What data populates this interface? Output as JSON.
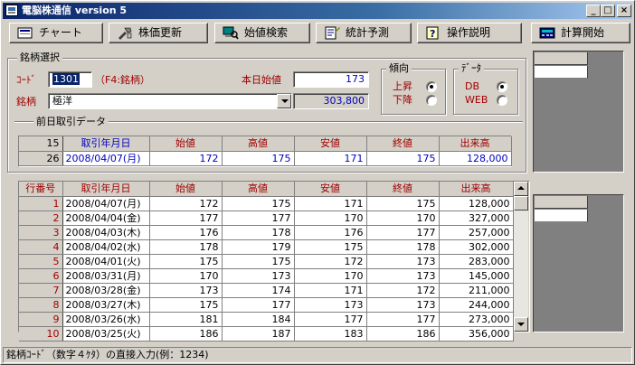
{
  "window": {
    "title": "電脳株通信 version 5",
    "min_label": "_",
    "max_label": "□",
    "close_label": "×"
  },
  "toolbar": {
    "chart": "チャート",
    "price_update": "株価更新",
    "open_search": "始値検索",
    "stat_forecast": "統計予測",
    "manual": "操作説明",
    "calc_start": "計算開始"
  },
  "selection": {
    "group_label": "銘柄選択",
    "code_label": "ｺｰﾄﾞ",
    "code_value": "1301",
    "code_hint": "（F4:銘柄）",
    "today_open_label": "本日始値",
    "today_open_value": "173",
    "name_label": "銘柄",
    "name_value": "極洋",
    "volume_value": "303,800"
  },
  "trend": {
    "group_label": "傾向",
    "up_label": "上昇",
    "down_label": "下降",
    "selected": "up"
  },
  "datasource": {
    "group_label": "ﾃﾞｰﾀ",
    "db_label": "DB",
    "web_label": "WEB",
    "selected": "DB"
  },
  "prev_day": {
    "group_label": "前日取引データ",
    "count": "15",
    "headers": [
      "取引年月日",
      "始値",
      "高値",
      "安値",
      "終値",
      "出来高"
    ],
    "row": {
      "num": "26",
      "date": "2008/04/07(月)",
      "open": "172",
      "high": "175",
      "low": "171",
      "close": "175",
      "volume": "128,000"
    }
  },
  "history": {
    "headers": [
      "行番号",
      "取引年月日",
      "始値",
      "高値",
      "安値",
      "終値",
      "出来高"
    ],
    "rows": [
      {
        "num": "1",
        "date": "2008/04/07(月)",
        "open": "172",
        "high": "175",
        "low": "171",
        "close": "175",
        "volume": "128,000"
      },
      {
        "num": "2",
        "date": "2008/04/04(金)",
        "open": "177",
        "high": "177",
        "low": "170",
        "close": "170",
        "volume": "327,000"
      },
      {
        "num": "3",
        "date": "2008/04/03(木)",
        "open": "176",
        "high": "178",
        "low": "176",
        "close": "177",
        "volume": "257,000"
      },
      {
        "num": "4",
        "date": "2008/04/02(水)",
        "open": "178",
        "high": "179",
        "low": "175",
        "close": "178",
        "volume": "302,000"
      },
      {
        "num": "5",
        "date": "2008/04/01(火)",
        "open": "175",
        "high": "175",
        "low": "172",
        "close": "173",
        "volume": "283,000"
      },
      {
        "num": "6",
        "date": "2008/03/31(月)",
        "open": "170",
        "high": "173",
        "low": "170",
        "close": "173",
        "volume": "145,000"
      },
      {
        "num": "7",
        "date": "2008/03/28(金)",
        "open": "173",
        "high": "174",
        "low": "171",
        "close": "172",
        "volume": "211,000"
      },
      {
        "num": "8",
        "date": "2008/03/27(木)",
        "open": "175",
        "high": "177",
        "low": "173",
        "close": "173",
        "volume": "244,000"
      },
      {
        "num": "9",
        "date": "2008/03/26(水)",
        "open": "181",
        "high": "184",
        "low": "177",
        "close": "177",
        "volume": "273,000"
      },
      {
        "num": "10",
        "date": "2008/03/25(火)",
        "open": "186",
        "high": "187",
        "low": "183",
        "close": "186",
        "volume": "356,000"
      }
    ]
  },
  "status": {
    "text": "銘柄ｺｰﾄﾞ（数字４ｹﾀ）の直接入力(例：1234)"
  },
  "colors": {
    "title_start": "#0a246a",
    "label_red": "#a00000",
    "value_blue": "#0000c0",
    "face": "#d4d0c8"
  }
}
